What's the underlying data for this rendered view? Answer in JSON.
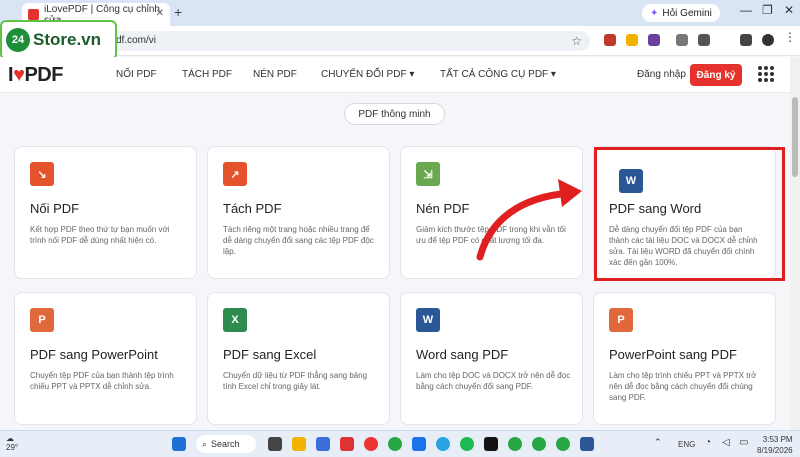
{
  "browser": {
    "tab_title": "iLovePDF | Công cụ chỉnh sửa",
    "url": "df.com/vi",
    "gemini_label": "Hỏi Gemini"
  },
  "overlay_logo": {
    "num": "24",
    "text": "Store.vn"
  },
  "site": {
    "brand_pre": "I",
    "brand_post": "PDF",
    "nav": [
      "NỐI PDF",
      "TÁCH PDF",
      "NÉN PDF",
      "CHUYỂN ĐỔI PDF ▾",
      "TẤT CẢ CÔNG CỤ PDF ▾"
    ],
    "login": "Đăng nhập",
    "signup": "Đăng ký"
  },
  "filter_pill": "PDF thông minh",
  "cards": [
    {
      "title": "Nối PDF",
      "desc": "Kết hợp PDF theo thứ tự bạn muốn với trình nối PDF dễ dùng nhất hiện có.",
      "icon": "merge-icon",
      "icon_glyph": "↘",
      "color": "#e5532d"
    },
    {
      "title": "Tách PDF",
      "desc": "Tách riêng một trang hoặc nhiều trang để dễ dàng chuyển đổi sang các tệp PDF độc lập.",
      "icon": "split-icon",
      "icon_glyph": "↗",
      "color": "#e5532d"
    },
    {
      "title": "Nén PDF",
      "desc": "Giảm kích thước tệp PDF trong khi vẫn tối ưu để tệp PDF có chất lượng tối đa.",
      "icon": "compress-icon",
      "icon_glyph": "⇲",
      "color": "#6aa84f"
    },
    {
      "title": "PDF sang Word",
      "desc": "Dễ dàng chuyển đổi tệp PDF của bạn thành các tài liệu DOC và DOCX dễ chỉnh sửa. Tài liệu WORD đã chuyển đổi chính xác đến gần 100%.",
      "icon": "word-icon",
      "icon_glyph": "W",
      "color": "#2b5797"
    },
    {
      "title": "PDF sang PowerPoint",
      "desc": "Chuyển tệp PDF của bạn thành tệp trình chiếu PPT và PPTX dễ chỉnh sửa.",
      "icon": "powerpoint-icon",
      "icon_glyph": "P",
      "color": "#e0683a"
    },
    {
      "title": "PDF sang Excel",
      "desc": "Chuyển dữ liệu từ PDF thẳng sang bảng tính Excel chỉ trong giây lát.",
      "icon": "excel-icon",
      "icon_glyph": "X",
      "color": "#2e8b4e"
    },
    {
      "title": "Word sang PDF",
      "desc": "Làm cho tệp DOC và DOCX trở nên dễ đọc bằng cách chuyển đổi sang PDF.",
      "icon": "word-to-pdf-icon",
      "icon_glyph": "W",
      "color": "#2b5797"
    },
    {
      "title": "PowerPoint sang PDF",
      "desc": "Làm cho tệp trình chiếu PPT và PPTX trở nên dễ đọc bằng cách chuyển đổi chúng sang PDF.",
      "icon": "ppt-to-pdf-icon",
      "icon_glyph": "P",
      "color": "#e0683a"
    }
  ],
  "taskbar": {
    "weather": "29°",
    "search": "Search",
    "lang": "ENG",
    "time": "3:53 PM",
    "date": "8/19/2026"
  }
}
